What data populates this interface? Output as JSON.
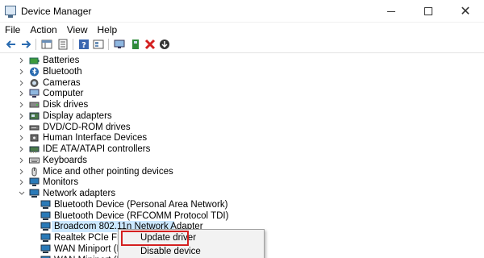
{
  "window": {
    "title": "Device Manager",
    "close_glyph": "✕"
  },
  "menu": [
    "File",
    "Action",
    "View",
    "Help"
  ],
  "toolbar": {
    "buttons": [
      "back-icon",
      "forward-icon",
      "show-hide-tree-icon",
      "properties-icon",
      "help-icon",
      "view-icon",
      "scan-hardware-icon",
      "update-driver-icon",
      "uninstall-icon",
      "disable-icon"
    ]
  },
  "tree": {
    "items": [
      {
        "label": "Batteries",
        "icon": "battery-icon",
        "expanded": false
      },
      {
        "label": "Bluetooth",
        "icon": "bluetooth-icon",
        "expanded": false
      },
      {
        "label": "Cameras",
        "icon": "camera-icon",
        "expanded": false
      },
      {
        "label": "Computer",
        "icon": "computer-icon",
        "expanded": false
      },
      {
        "label": "Disk drives",
        "icon": "disk-drive-icon",
        "expanded": false
      },
      {
        "label": "Display adapters",
        "icon": "display-adapter-icon",
        "expanded": false
      },
      {
        "label": "DVD/CD-ROM drives",
        "icon": "dvd-drive-icon",
        "expanded": false
      },
      {
        "label": "Human Interface Devices",
        "icon": "hid-icon",
        "expanded": false
      },
      {
        "label": "IDE ATA/ATAPI controllers",
        "icon": "ide-controller-icon",
        "expanded": false
      },
      {
        "label": "Keyboards",
        "icon": "keyboard-icon",
        "expanded": false
      },
      {
        "label": "Mice and other pointing devices",
        "icon": "mouse-icon",
        "expanded": false
      },
      {
        "label": "Monitors",
        "icon": "monitor-icon",
        "expanded": false
      },
      {
        "label": "Network adapters",
        "icon": "network-adapter-icon",
        "expanded": true
      }
    ],
    "network_children": [
      {
        "label": "Bluetooth Device (Personal Area Network)",
        "selected": false
      },
      {
        "label": "Bluetooth Device (RFCOMM Protocol TDI)",
        "selected": false
      },
      {
        "label": "Broadcom 802.11n Network Adapter",
        "selected": true
      },
      {
        "label": "Realtek PCIe FE Fam",
        "selected": false
      },
      {
        "label": "WAN Miniport (IKEv",
        "selected": false
      },
      {
        "label": "WAN Miniport (I",
        "selected": false
      }
    ]
  },
  "context_menu": {
    "items": [
      "Update driver",
      "Disable device"
    ],
    "highlighted": "Update driver",
    "highlight_color": "#d42020"
  },
  "colors": {
    "selection": "#cce8ff",
    "network_icon": "#2a7ab8"
  }
}
